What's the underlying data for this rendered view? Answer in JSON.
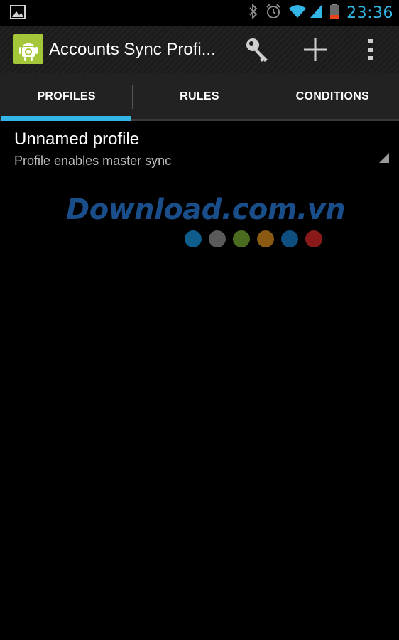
{
  "status_bar": {
    "time": "23:36",
    "icons": [
      "image-icon",
      "bluetooth-icon",
      "alarm-icon",
      "wifi-icon",
      "signal-icon",
      "battery-icon"
    ],
    "clock_color": "#33b5e5"
  },
  "action_bar": {
    "title": "Accounts Sync Profi...",
    "app_icon": "android-icon",
    "actions": [
      {
        "name": "key-icon"
      },
      {
        "name": "add-icon"
      },
      {
        "name": "overflow-menu-icon"
      }
    ]
  },
  "tabs": [
    {
      "label": "PROFILES",
      "selected": true
    },
    {
      "label": "RULES",
      "selected": false
    },
    {
      "label": "CONDITIONS",
      "selected": false
    }
  ],
  "accent_color": "#33b5e5",
  "profiles": [
    {
      "title": "Unnamed profile",
      "subtitle": "Profile enables master sync"
    }
  ],
  "watermark": {
    "text": "Download.com.vn",
    "dot_colors": [
      "#0e5d8c",
      "#5a5a5a",
      "#4b6b1e",
      "#8a5a12",
      "#0e4f80",
      "#8a1a1a"
    ]
  }
}
